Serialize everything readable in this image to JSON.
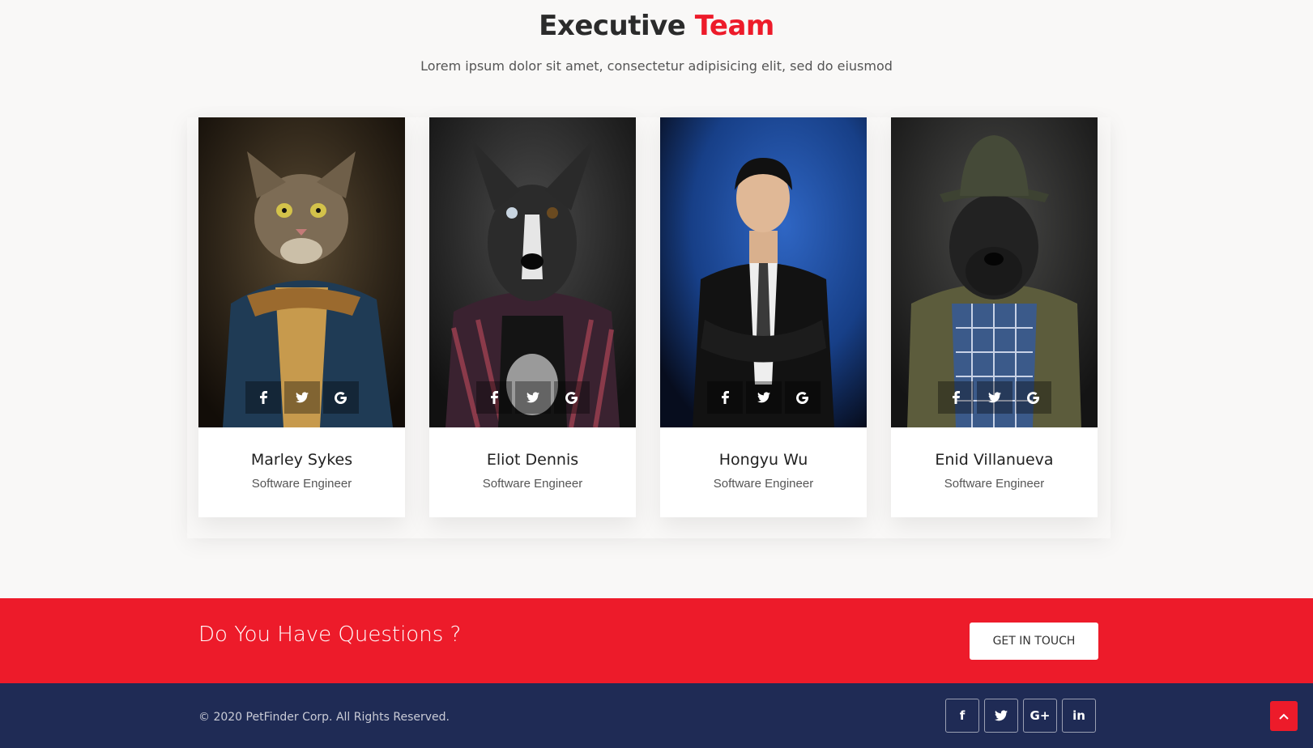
{
  "section": {
    "title_main": "Executive",
    "title_accent": "Team",
    "subtitle": "Lorem ipsum dolor sit amet, consectetur adipisicing elit, sed do eiusmod"
  },
  "team": [
    {
      "name": "Marley Sykes",
      "role": "Software Engineer",
      "photo": "cat-portrait"
    },
    {
      "name": "Eliot Dennis",
      "role": "Software Engineer",
      "photo": "dog-portrait"
    },
    {
      "name": "Hongyu Wu",
      "role": "Software Engineer",
      "photo": "man-portrait"
    },
    {
      "name": "Enid Villanueva",
      "role": "Software Engineer",
      "photo": "dog-hat-portrait"
    }
  ],
  "card_socials": [
    "facebook-icon",
    "twitter-icon",
    "google-icon"
  ],
  "cta": {
    "text": "Do You Have Questions ?",
    "button_label": "GET IN TOUCH"
  },
  "footer": {
    "copyright": "© 2020 PetFinder Corp. All Rights Reserved.",
    "socials": {
      "facebook": "f",
      "twitter": "twitter-icon",
      "google_plus": "G+",
      "linkedin": "in"
    }
  },
  "colors": {
    "accent": "#ed1b2a",
    "footer_bg": "#1f2b55",
    "page_bg": "#f9f8f7"
  }
}
